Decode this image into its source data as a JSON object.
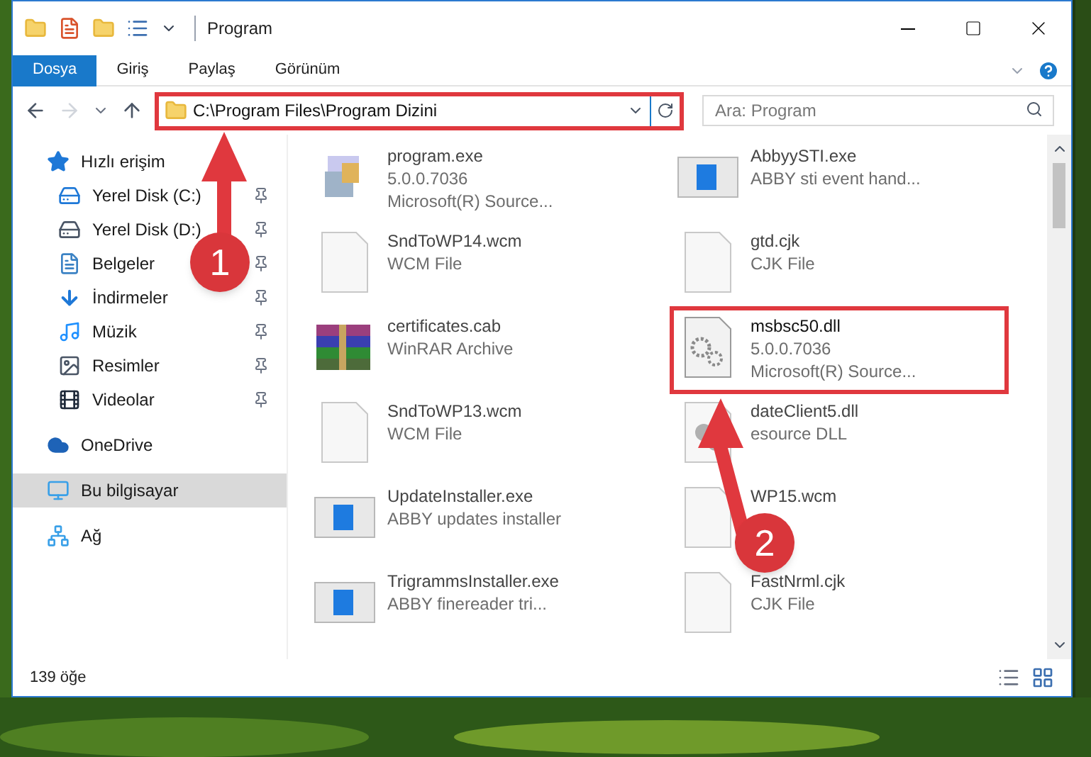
{
  "window": {
    "title": "Program"
  },
  "ribbon_tabs": [
    {
      "label": "Dosya",
      "selected": true
    },
    {
      "label": "Giriş",
      "selected": false
    },
    {
      "label": "Paylaş",
      "selected": false
    },
    {
      "label": "Görünüm",
      "selected": false
    }
  ],
  "address_bar": {
    "path": "C:\\Program Files\\Program Dizini"
  },
  "search": {
    "placeholder": "Ara: Program"
  },
  "sidebar": {
    "items": [
      {
        "label": "Hızlı erişim",
        "kind": "quick",
        "selected": false,
        "children": [
          {
            "label": "Yerel Disk (C:)",
            "kind": "diskc",
            "selected": false,
            "pinned": true
          },
          {
            "label": "Yerel Disk (D:)",
            "kind": "disk",
            "selected": false,
            "pinned": true
          },
          {
            "label": "Belgeler",
            "kind": "docs",
            "selected": false,
            "pinned": true
          },
          {
            "label": "İndirmeler",
            "kind": "downloads",
            "selected": false,
            "pinned": true
          },
          {
            "label": "Müzik",
            "kind": "music",
            "selected": false,
            "pinned": true
          },
          {
            "label": "Resimler",
            "kind": "pictures",
            "selected": false,
            "pinned": true
          },
          {
            "label": "Videolar",
            "kind": "videos",
            "selected": false,
            "pinned": true
          }
        ]
      },
      {
        "label": "OneDrive",
        "kind": "cloud",
        "selected": false
      },
      {
        "label": "Bu bilgisayar",
        "kind": "pc",
        "selected": true
      },
      {
        "label": "Ağ",
        "kind": "network",
        "selected": false
      }
    ]
  },
  "files": [
    {
      "name": "program.exe",
      "lines": [
        "5.0.0.7036",
        "Microsoft(R) Source..."
      ],
      "kind": "installer",
      "highlighted": false
    },
    {
      "name": "AbbyySTI.exe",
      "lines": [
        "ABBY sti event hand..."
      ],
      "kind": "window",
      "highlighted": false
    },
    {
      "name": "SndToWP14.wcm",
      "lines": [
        "WCM File"
      ],
      "kind": "blank",
      "highlighted": false
    },
    {
      "name": "gtd.cjk",
      "lines": [
        "CJK File"
      ],
      "kind": "blank",
      "highlighted": false
    },
    {
      "name": "certificates.cab",
      "lines": [
        "WinRAR Archive"
      ],
      "kind": "archive",
      "highlighted": false
    },
    {
      "name": "msbsc50.dll",
      "lines": [
        "5.0.0.7036",
        "Microsoft(R) Source..."
      ],
      "kind": "gear",
      "highlighted": true
    },
    {
      "name": "SndToWP13.wcm",
      "lines": [
        "WCM File"
      ],
      "kind": "blank",
      "highlighted": false
    },
    {
      "name": "dateClient5.dll",
      "lines": [
        "esource DLL"
      ],
      "kind": "graygear",
      "highlighted": false
    },
    {
      "name": "UpdateInstaller.exe",
      "lines": [
        "ABBY updates installer"
      ],
      "kind": "window",
      "highlighted": false
    },
    {
      "name": "WP15.wcm",
      "kind": "blank",
      "highlighted": false
    },
    {
      "name": "TrigrammsInstaller.exe",
      "lines": [
        "ABBY finereader tri..."
      ],
      "kind": "window",
      "highlighted": false
    },
    {
      "name": "FastNrml.cjk",
      "lines": [
        "CJK File"
      ],
      "kind": "blank",
      "highlighted": false
    }
  ],
  "status_bar": {
    "count": "139 öğe"
  },
  "annotations": [
    {
      "label": "1"
    },
    {
      "label": "2"
    }
  ]
}
